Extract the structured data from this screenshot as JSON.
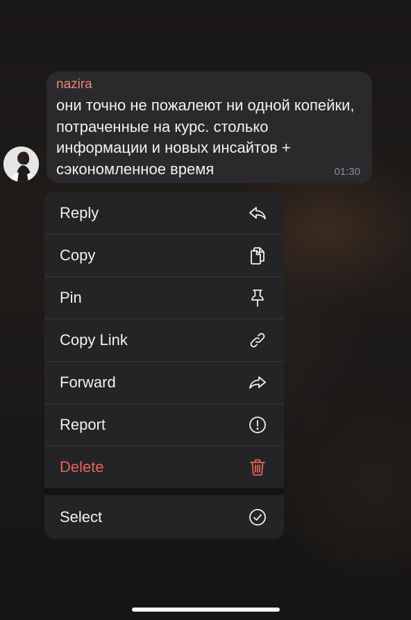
{
  "message": {
    "sender": "nazira",
    "text": "они точно не пожалеют ни одной копейки, потраченные на курс. столько информации и новых инсайтов + сэкономленное время",
    "time": "01:30"
  },
  "context_menu": {
    "items": [
      {
        "label": "Reply",
        "icon": "reply-icon"
      },
      {
        "label": "Copy",
        "icon": "copy-icon"
      },
      {
        "label": "Pin",
        "icon": "pin-icon"
      },
      {
        "label": "Copy Link",
        "icon": "link-icon"
      },
      {
        "label": "Forward",
        "icon": "forward-icon"
      },
      {
        "label": "Report",
        "icon": "report-icon"
      },
      {
        "label": "Delete",
        "icon": "trash-icon",
        "color": "#e3665a"
      }
    ],
    "select": {
      "label": "Select",
      "icon": "check-circle-icon"
    }
  },
  "colors": {
    "sender_name": "#f2877a",
    "bubble": "#2a2a2c",
    "menu": "#242325",
    "danger": "#e3665a"
  }
}
